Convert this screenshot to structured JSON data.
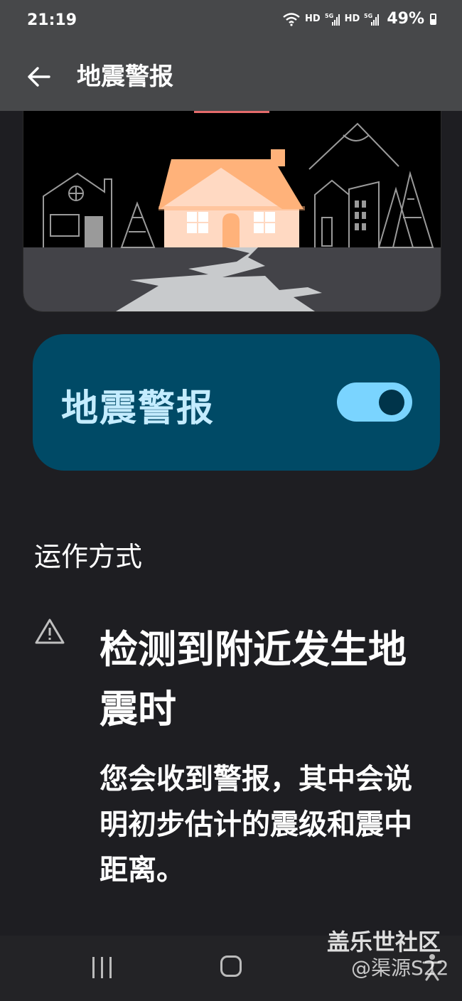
{
  "status_bar": {
    "time": "21:19",
    "net1_label": "HD",
    "net1_gen": "5G",
    "net2_label": "HD",
    "net2_gen": "5G",
    "battery": "49%"
  },
  "app_bar": {
    "back_icon": "arrow-left-icon",
    "title": "地震警报"
  },
  "toggle_card": {
    "label": "地震警报",
    "enabled": true
  },
  "section": {
    "heading": "运作方式"
  },
  "how_it_works": {
    "icon": "warning-triangle-icon",
    "title": "检测到附近发生地震时",
    "body": "您会收到警报，其中会说明初步估计的震级和震中距离。"
  },
  "watermark": {
    "line1": "盖乐世社区",
    "line2": "@渠源S22"
  },
  "colors": {
    "card_bg": "#004a66",
    "card_text": "#c4ecff",
    "switch_track": "#7ad4ff",
    "house_roof": "#ffb27a",
    "house_wall": "#ffd9c2"
  }
}
